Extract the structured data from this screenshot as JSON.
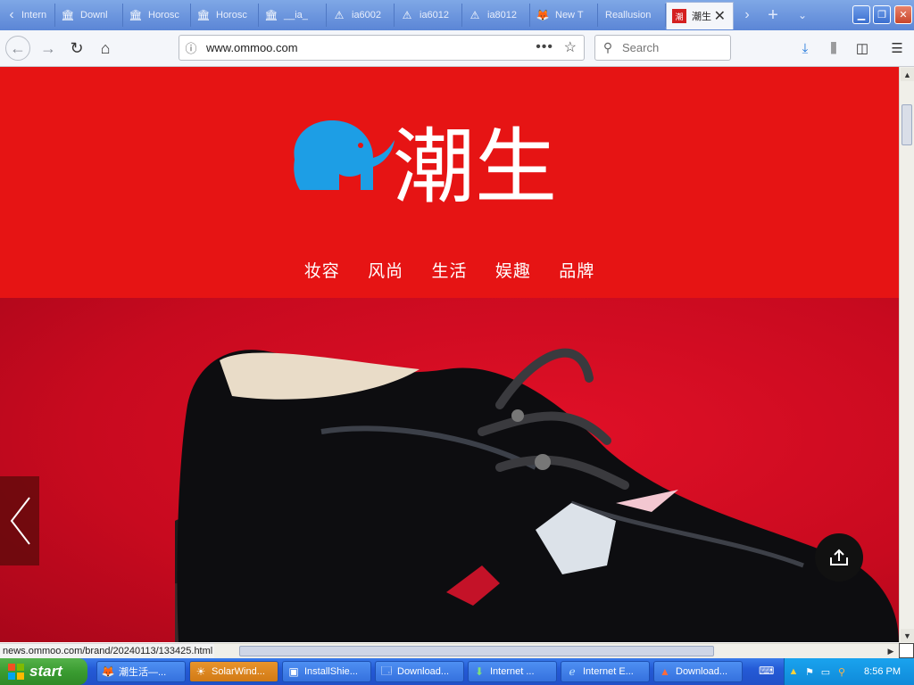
{
  "browser": {
    "tabs": [
      {
        "label": "Intern",
        "icon": "chevron-left-icon"
      },
      {
        "label": "Downl",
        "icon": "museum-icon"
      },
      {
        "label": "Horosc",
        "icon": "museum-icon"
      },
      {
        "label": "Horosc",
        "icon": "museum-icon"
      },
      {
        "label": "__ia_",
        "icon": "museum-icon"
      },
      {
        "label": "ia6002",
        "icon": "warning-icon"
      },
      {
        "label": "ia6012",
        "icon": "warning-icon"
      },
      {
        "label": "ia8012",
        "icon": "warning-icon"
      },
      {
        "label": "New T",
        "icon": "firefox-icon"
      },
      {
        "label": "Reallusion",
        "icon": ""
      },
      {
        "label": "潮生",
        "icon": "ommoo-icon",
        "active": true
      }
    ],
    "url": "www.ommoo.com",
    "search_placeholder": "Search",
    "status_url": "news.ommoo.com/brand/20240113/133425.html"
  },
  "page": {
    "logo_text": "潮生",
    "nav": [
      "妆容",
      "风尚",
      "生活",
      "娱趣",
      "品牌"
    ],
    "colors": {
      "brand_red": "#e61414",
      "elephant_blue": "#1d9ee5"
    }
  },
  "taskbar": {
    "start_label": "start",
    "tasks": [
      {
        "label": "潮生活—...",
        "icon": "firefox-icon"
      },
      {
        "label": "SolarWind...",
        "icon": "solarwinds-icon",
        "active": true
      },
      {
        "label": "InstallShie...",
        "icon": "installer-icon"
      },
      {
        "label": "Download...",
        "icon": "window-icon"
      },
      {
        "label": "Internet ...",
        "icon": "download-arrow-icon"
      },
      {
        "label": "Internet E...",
        "icon": "ie-icon"
      },
      {
        "label": "Download...",
        "icon": "triangle-icon"
      }
    ],
    "clock": "8:56 PM"
  }
}
